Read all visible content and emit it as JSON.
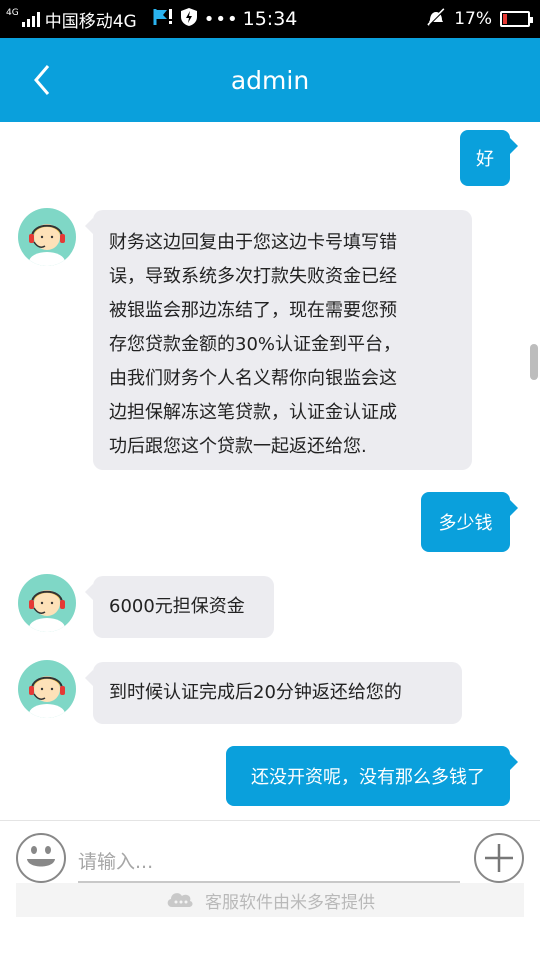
{
  "status_bar": {
    "carrier": "中国移动4G",
    "net_tag": "4G",
    "time": "15:34",
    "battery": "17%",
    "battery_level": 0.17
  },
  "header": {
    "title": "admin"
  },
  "messages": [
    {
      "side": "right",
      "text": "好"
    },
    {
      "side": "left",
      "lines": [
        "财务这边回复由于您这边卡号填写错",
        "误，导致系统多次打款失败资金已经",
        "被银监会那边冻结了，现在需要您预",
        "存您贷款金额的30%认证金到平台，",
        "由我们财务个人名义帮你向银监会这",
        "边担保解冻这笔贷款，认证金认证成",
        "功后跟您这个贷款一起返还给您."
      ]
    },
    {
      "side": "right",
      "text": "多少钱"
    },
    {
      "side": "left",
      "text": "6000元担保资金"
    },
    {
      "side": "left",
      "text": "到时候认证完成后20分钟返还给您的"
    },
    {
      "side": "right",
      "text": "还没开资呢，没有那么多钱了"
    }
  ],
  "input": {
    "placeholder": "请输入..."
  },
  "footer": {
    "powered_by": "客服软件由米多客提供"
  },
  "colors": {
    "accent": "#0aa0dc",
    "bubble_left": "#ececf0",
    "avatar_bg": "#7fd7c6"
  }
}
